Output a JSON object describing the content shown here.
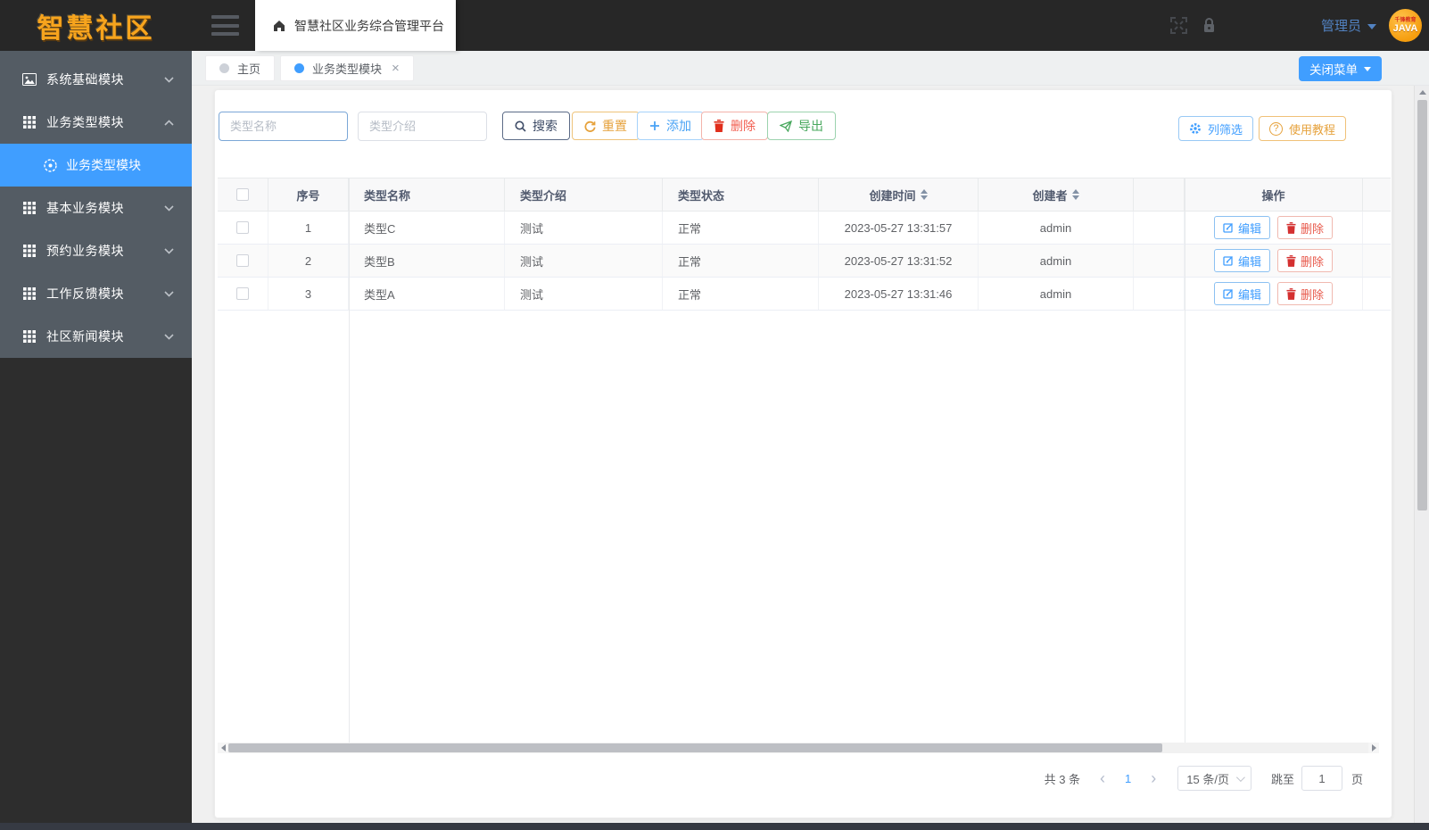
{
  "header": {
    "logo": "智慧社区",
    "app_title": "智慧社区业务综合管理平台",
    "user_name": "管理员",
    "avatar_text": "JAVA",
    "avatar_top_text": "千锋教育"
  },
  "tabs": {
    "home": "主页",
    "active": "业务类型模块",
    "close_char": "×"
  },
  "close_menu_label": "关闭菜单",
  "sidebar": {
    "items": [
      {
        "label": "系统基础模块"
      },
      {
        "label": "业务类型模块"
      },
      {
        "label": "基本业务模块"
      },
      {
        "label": "预约业务模块"
      },
      {
        "label": "工作反馈模块"
      },
      {
        "label": "社区新闻模块"
      }
    ],
    "active_submenu": "业务类型模块"
  },
  "toolbar": {
    "name_placeholder": "类型名称",
    "intro_placeholder": "类型介绍",
    "search_label": "搜索",
    "reset_label": "重置",
    "add_label": "添加",
    "delete_label": "删除",
    "export_label": "导出",
    "column_filter_label": "列筛选",
    "tutorial_label": "使用教程",
    "tutorial_icon_char": "?"
  },
  "table": {
    "headers": {
      "no": "序号",
      "name": "类型名称",
      "intro": "类型介绍",
      "status": "类型状态",
      "created": "创建时间",
      "creator": "创建者",
      "actions": "操作"
    },
    "rows": [
      {
        "no": "1",
        "name": "类型C",
        "intro": "测试",
        "status": "正常",
        "created": "2023-05-27 13:31:57",
        "creator": "admin"
      },
      {
        "no": "2",
        "name": "类型B",
        "intro": "测试",
        "status": "正常",
        "created": "2023-05-27 13:31:52",
        "creator": "admin"
      },
      {
        "no": "3",
        "name": "类型A",
        "intro": "测试",
        "status": "正常",
        "created": "2023-05-27 13:31:46",
        "creator": "admin"
      }
    ],
    "edit_label": "编辑",
    "delete_label": "删除"
  },
  "pagination": {
    "total_label": "共 3 条",
    "prev_char": "‹",
    "next_char": "›",
    "current_page": "1",
    "page_size_label": "15 条/页",
    "jump_label": "跳至",
    "jump_value": "1",
    "page_unit": "页"
  },
  "colors": {
    "primary": "#409EFF",
    "warning": "#E6A23C",
    "danger": "#F56C6C",
    "success": "#49A85E",
    "sidebar_bg": "#545c64",
    "header_bg": "#272727",
    "logo_orange": "#F7A41D"
  }
}
